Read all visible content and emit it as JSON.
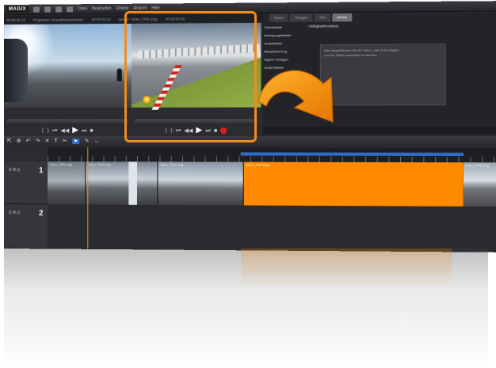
{
  "app": {
    "logo": "MAGIX",
    "menu": [
      "Datei",
      "Bearbeiten",
      "Effekte",
      "Ansicht",
      "Hilfe"
    ]
  },
  "infobar": {
    "left_time": "00:00:26:13",
    "project": "Programm: Stumpfmanipulation",
    "mid_time": "00:00:01:13",
    "source": "Quelle: Video_TRS.mpg",
    "right_time": "00:00:00:00"
  },
  "media_pool": {
    "tabs": [
      "Import",
      "Vorlagen",
      "Titel",
      "Effekte"
    ],
    "active_tab_index": 3,
    "categories": [
      "Videoeffekte",
      "Bewegungseffekte",
      "Audioeffekte",
      "Bildoptimierung",
      "Eigene Vorlagen",
      "Audio Effekte"
    ],
    "header": "Helligkeit/Kontrast",
    "hint_lines": [
      "Hier doppelklicken Sie ein Video- oder Foto-Objekt,",
      "um den Effekt anwenden zu können."
    ]
  },
  "timeline": {
    "tracks": [
      {
        "number": "1",
        "icons": "S M ⊡"
      },
      {
        "number": "2",
        "icons": "S M ⊡"
      }
    ],
    "clips": [
      "Video_TRS.mpg",
      "Video_TRS.mpg",
      "Video_TRS.mpg",
      "Video_TRS.mpg",
      "Video_TRS.mpg"
    ]
  },
  "colors": {
    "accent_orange": "#ff8a00",
    "frame_orange": "#f08b1d",
    "record_red": "#e11d1d",
    "selection_blue": "#2f6cc9"
  },
  "icons": [
    "play-icon",
    "rewind-icon",
    "forward-icon",
    "stop-icon",
    "record-icon",
    "curved-arrow-icon",
    "scissors-icon",
    "undo-icon",
    "redo-icon"
  ]
}
